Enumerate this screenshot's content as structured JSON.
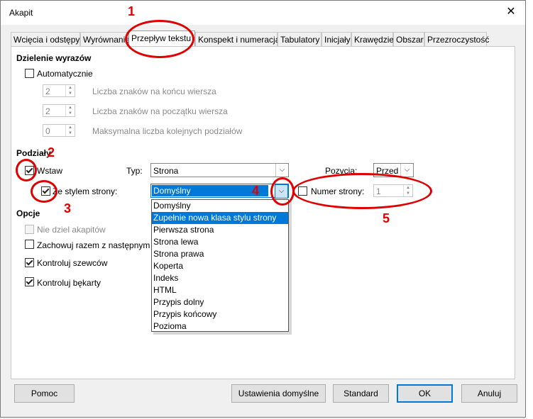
{
  "window": {
    "title": "Akapit",
    "close_glyph": "✕"
  },
  "tabs": [
    "Wcięcia i odstępy",
    "Wyrównanie",
    "Przepływ tekstu",
    "Konspekt i numeracja",
    "Tabulatory",
    "Inicjały",
    "Krawędzie",
    "Obszar",
    "Przezroczystość"
  ],
  "hyphenation": {
    "heading": "Dzielenie wyrazów",
    "auto_label": "Automatycznie",
    "end_value": "2",
    "end_label": "Liczba znaków na końcu wiersza",
    "start_value": "2",
    "start_label": "Liczba znaków na początku wiersza",
    "max_value": "0",
    "max_label": "Maksymalna liczba kolejnych podziałów"
  },
  "breaks": {
    "heading": "Podziały",
    "insert_label": "Wstaw",
    "type_label": "Typ:",
    "type_value": "Strona",
    "position_label": "Pozycja:",
    "position_value": "Przed",
    "page_style_label": "Ze stylem strony:",
    "page_style_value": "Domyślny",
    "page_number_label": "Numer strony:",
    "page_number_value": "1"
  },
  "options": {
    "heading": "Opcje",
    "no_split": "Nie dziel akapitów",
    "keep_next": "Zachowuj razem z następnym a",
    "orphan": "Kontroluj szewców",
    "widow": "Kontroluj bękarty"
  },
  "dropdown": [
    "Domyślny",
    "Zupełnie nowa klasa stylu strony",
    "Pierwsza strona",
    "Strona lewa",
    "Strona prawa",
    "Koperta",
    "Indeks",
    "HTML",
    "Przypis dolny",
    "Przypis końcowy",
    "Pozioma"
  ],
  "buttons": {
    "help": "Pomoc",
    "reset": "Ustawienia domyślne",
    "standard": "Standard",
    "ok": "OK",
    "cancel": "Anuluj"
  },
  "annotations": [
    "1",
    "2",
    "3",
    "4",
    "5"
  ],
  "colors": {
    "annotation": "#e00000",
    "selection": "#0078d7"
  }
}
